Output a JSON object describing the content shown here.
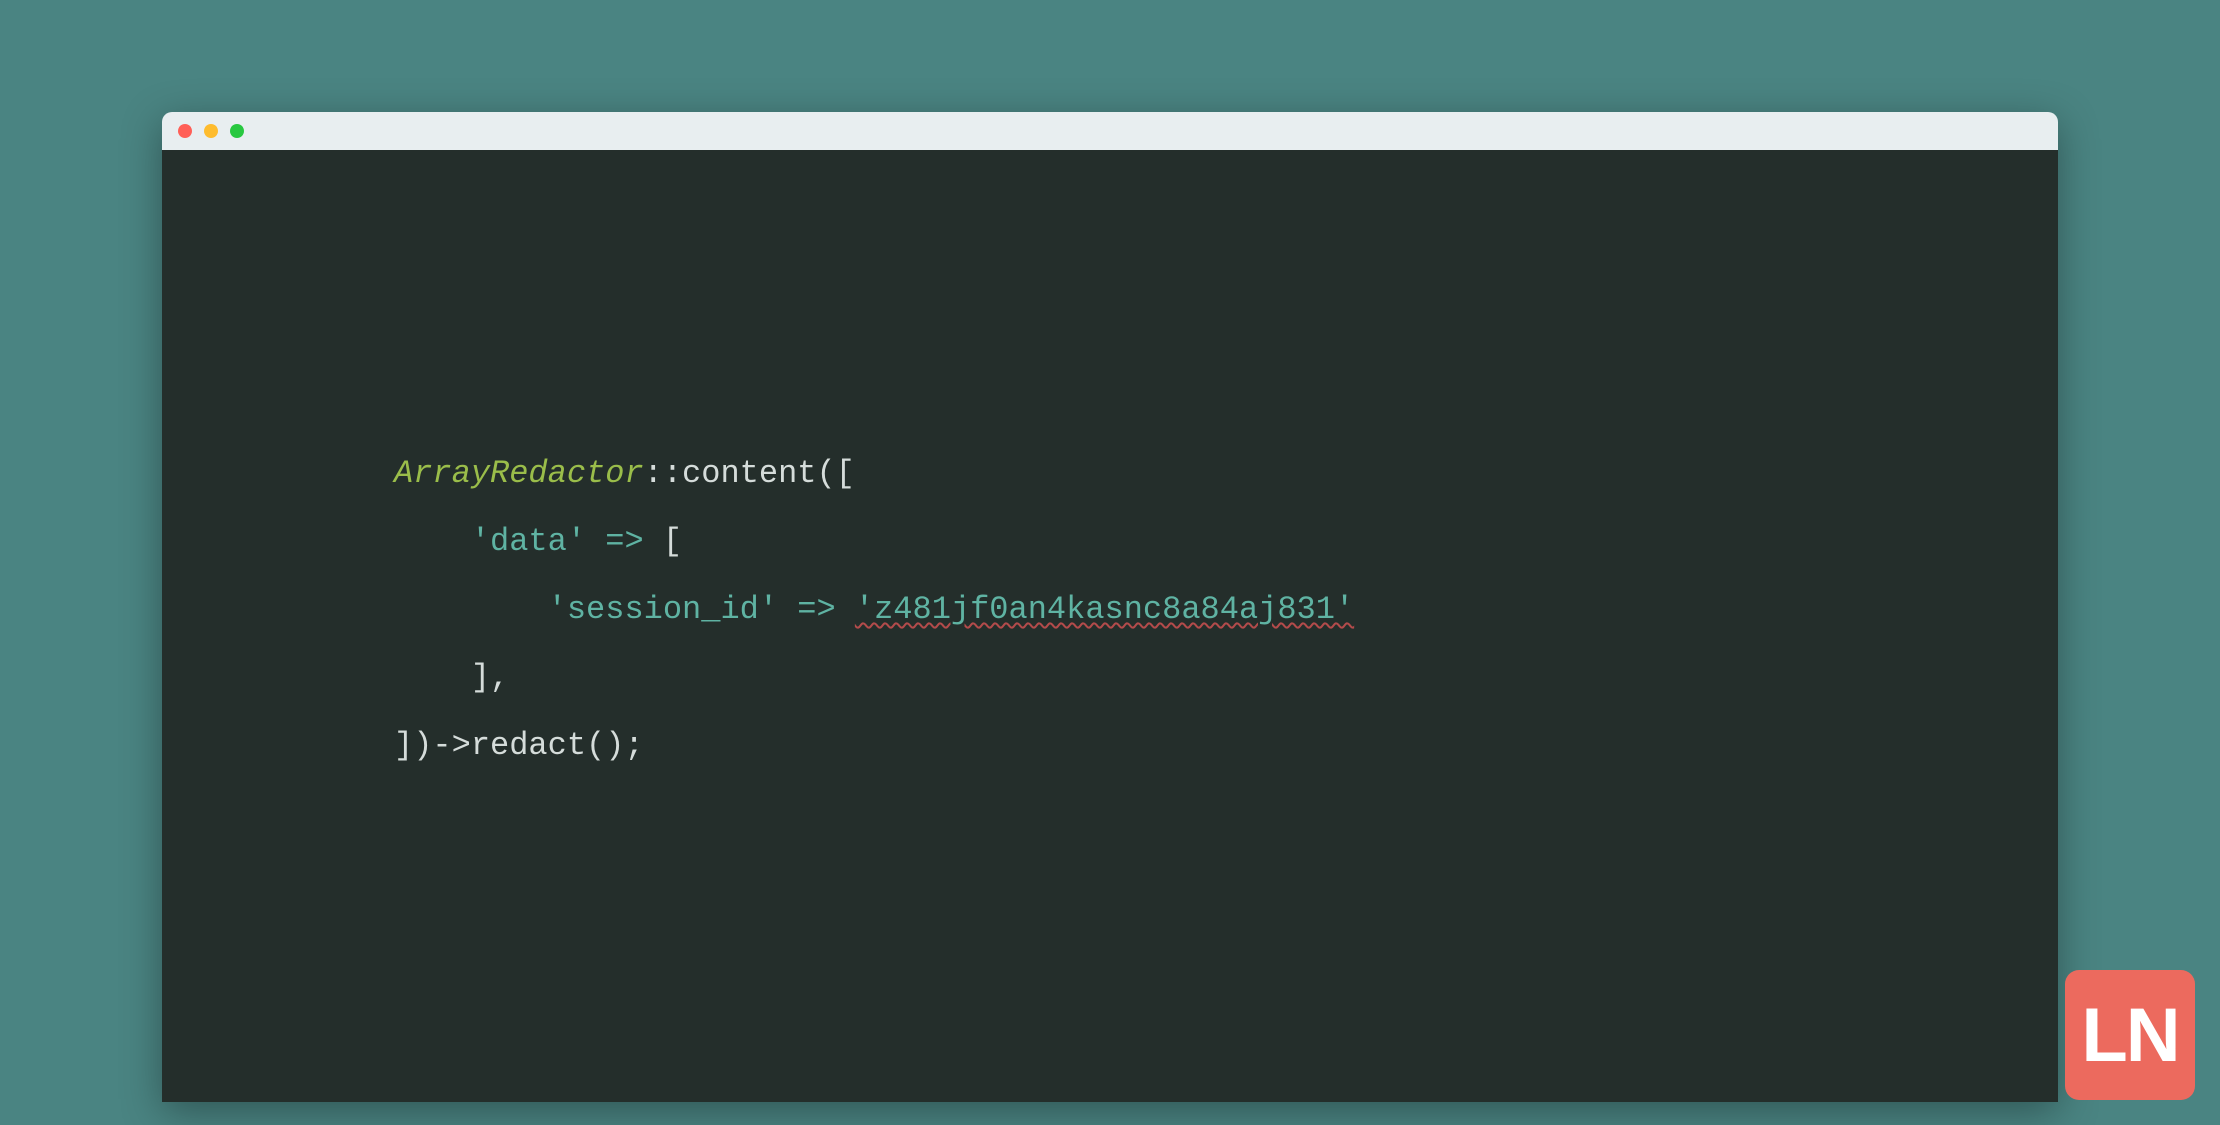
{
  "colors": {
    "background": "#4a8482",
    "editor_bg": "#242e2b",
    "titlebar_bg": "#e8eef0",
    "traffic_close": "#ff5f57",
    "traffic_min": "#febc2e",
    "traffic_max": "#28c840",
    "token_class": "#9abd4a",
    "token_string": "#5fb3a3",
    "token_default": "#d5dcda",
    "badge_bg": "#ec6a5e",
    "squiggle": "#b34b4b"
  },
  "code": {
    "line1": {
      "class_name": "ArrayRedactor",
      "scope": "::",
      "method": "content",
      "open": "(["
    },
    "line2": {
      "indent": "    ",
      "key": "'data'",
      "arrow": " => ",
      "bracket": "["
    },
    "line3": {
      "indent": "        ",
      "key": "'session_id'",
      "arrow": " => ",
      "value": "'z481jf0an4kasnc8a84aj831'"
    },
    "line4": {
      "indent": "    ",
      "close": "],"
    },
    "line5": {
      "close_chain": "])->",
      "method": "redact",
      "tail": "();"
    }
  },
  "badge": {
    "text": "LN"
  }
}
